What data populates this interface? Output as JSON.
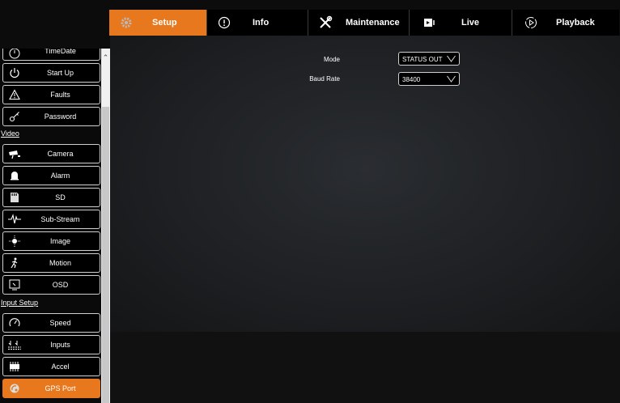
{
  "nav": {
    "tabs": [
      {
        "label": "Setup",
        "icon": "gear-icon",
        "active": true
      },
      {
        "label": "Info",
        "icon": "info-icon",
        "active": false
      },
      {
        "label": "Maintenance",
        "icon": "tools-icon",
        "active": false
      },
      {
        "label": "Live",
        "icon": "video-camera-icon",
        "active": false
      },
      {
        "label": "Playback",
        "icon": "play-circle-icon",
        "active": false
      }
    ]
  },
  "sidebar": {
    "items": [
      {
        "label": "TimeDate",
        "icon": "clock-icon"
      },
      {
        "label": "Start Up",
        "icon": "power-icon"
      },
      {
        "label": "Faults",
        "icon": "warning-icon"
      },
      {
        "label": "Password",
        "icon": "key-icon"
      },
      {
        "label": "Camera",
        "icon": "camera-icon"
      },
      {
        "label": "Alarm",
        "icon": "bell-icon"
      },
      {
        "label": "SD",
        "icon": "sd-card-icon"
      },
      {
        "label": "Sub-Stream",
        "icon": "waveform-icon"
      },
      {
        "label": "Image",
        "icon": "brightness-icon"
      },
      {
        "label": "Motion",
        "icon": "motion-icon"
      },
      {
        "label": "OSD",
        "icon": "monitor-icon"
      },
      {
        "label": "Speed",
        "icon": "speedometer-icon"
      },
      {
        "label": "Inputs",
        "icon": "inputs-icon"
      },
      {
        "label": "Accel",
        "icon": "accelerometer-icon"
      },
      {
        "label": "GPS Port",
        "icon": "satellite-icon"
      }
    ],
    "sections": {
      "video": "Video",
      "input_setup": "Input Setup"
    }
  },
  "form": {
    "mode_label": "Mode",
    "mode_value": "STATUS OUT",
    "baud_label": "Baud Rate",
    "baud_value": "38400"
  },
  "colors": {
    "accent": "#e8781e",
    "background": "#0c0c0c"
  }
}
